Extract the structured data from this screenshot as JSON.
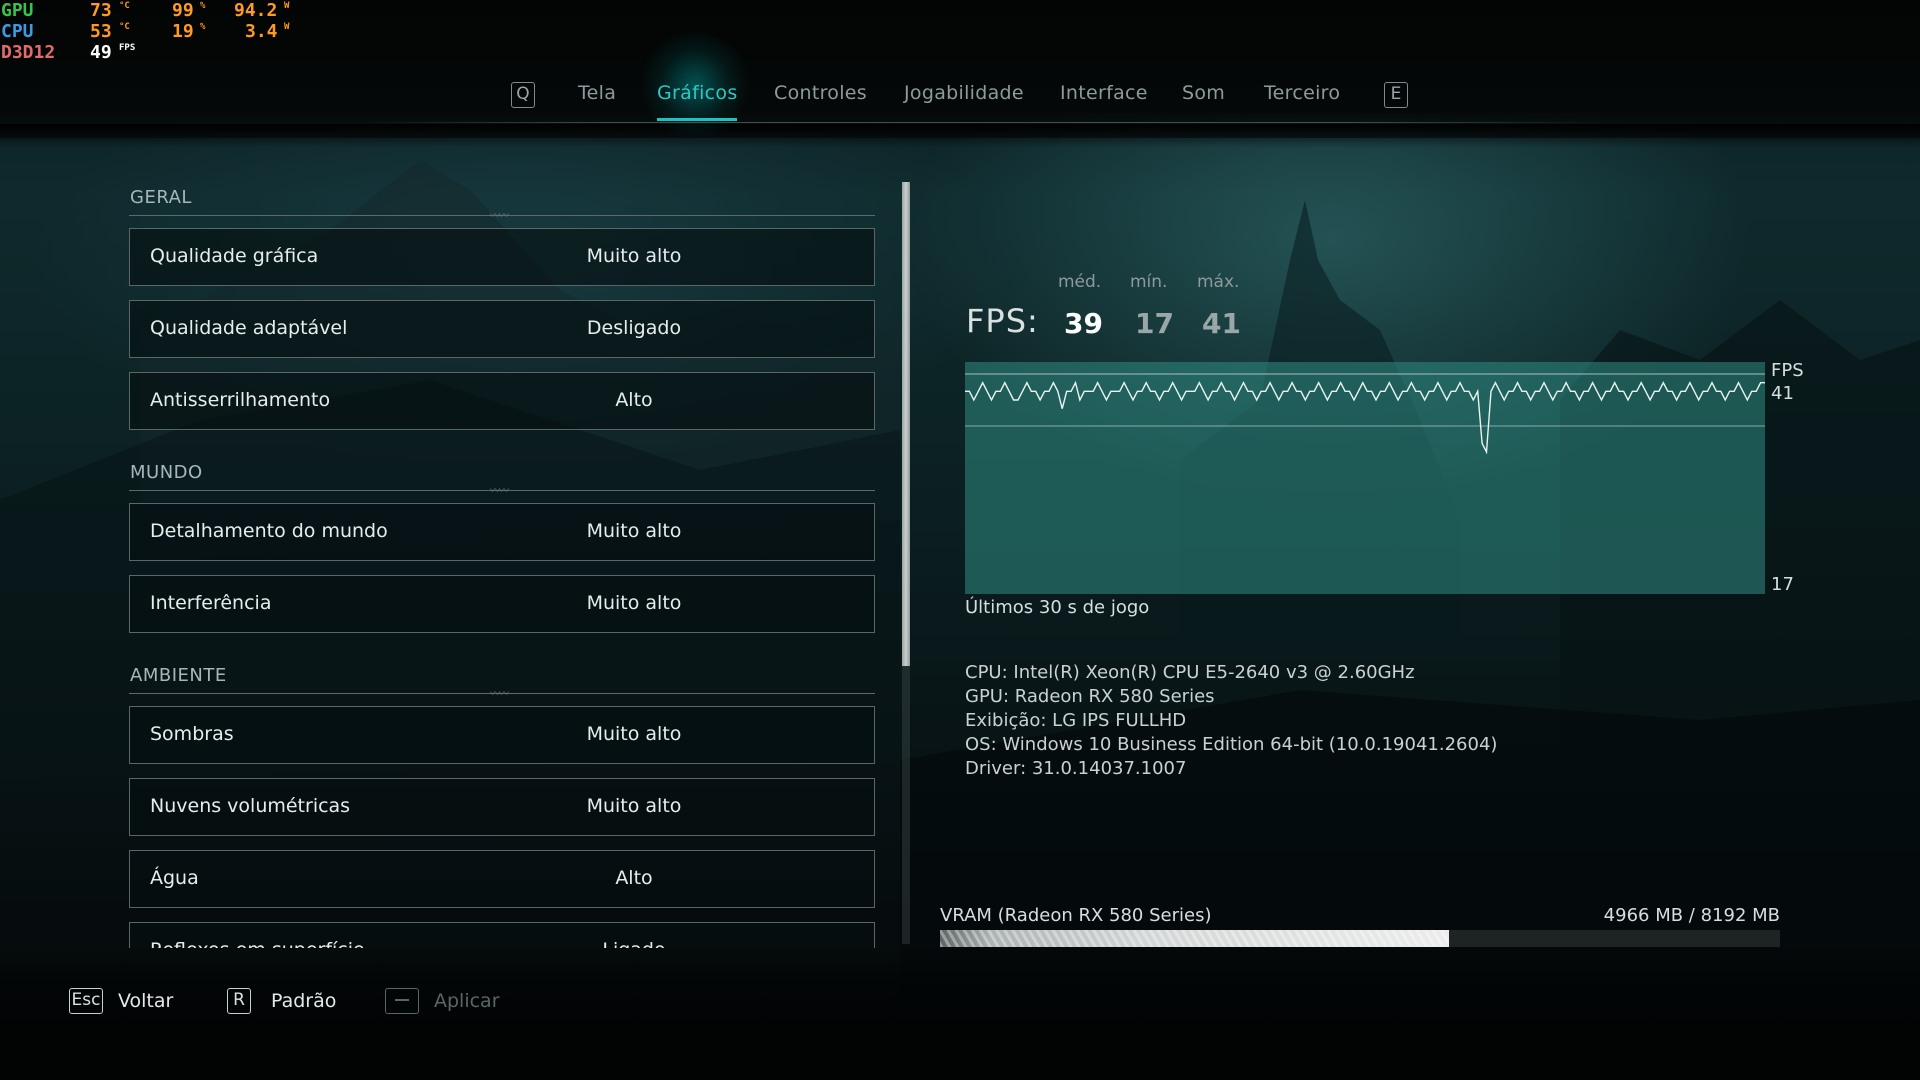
{
  "osd": {
    "rows": [
      {
        "name": "GPU",
        "v1": "73",
        "u1": "°C",
        "v2": "99",
        "u2": "%",
        "v3": "94.2",
        "u3": "W"
      },
      {
        "name": "CPU",
        "v1": "53",
        "u1": "°C",
        "v2": "19",
        "u2": "%",
        "v3": "3.4",
        "u3": "W"
      },
      {
        "name": "D3D12",
        "v1": "49",
        "u1": "FPS"
      }
    ],
    "colors": {
      "gpu": "#38c447",
      "cpu": "#3c9be6",
      "d3d": "#e36b6b",
      "values": "#ff9a24"
    }
  },
  "tabs": {
    "prev_key": "Q",
    "next_key": "E",
    "items": [
      {
        "label": "Tela",
        "active": false
      },
      {
        "label": "Gráficos",
        "active": true
      },
      {
        "label": "Controles",
        "active": false
      },
      {
        "label": "Jogabilidade",
        "active": false
      },
      {
        "label": "Interface",
        "active": false
      },
      {
        "label": "Som",
        "active": false
      },
      {
        "label": "Terceiro",
        "active": false
      }
    ],
    "accent_color": "#29c9c4"
  },
  "sections": [
    {
      "title": "GERAL",
      "settings": [
        {
          "label": "Qualidade gráfica",
          "value": "Muito alto"
        },
        {
          "label": "Qualidade adaptável",
          "value": "Desligado"
        },
        {
          "label": "Antisserrilhamento",
          "value": "Alto"
        }
      ]
    },
    {
      "title": "MUNDO",
      "settings": [
        {
          "label": "Detalhamento do mundo",
          "value": "Muito alto"
        },
        {
          "label": "Interferência",
          "value": "Muito alto"
        }
      ]
    },
    {
      "title": "AMBIENTE",
      "settings": [
        {
          "label": "Sombras",
          "value": "Muito alto"
        },
        {
          "label": "Nuvens volumétricas",
          "value": "Muito alto"
        },
        {
          "label": "Água",
          "value": "Alto"
        },
        {
          "label": "Reflexos em superfície",
          "value": "Ligado"
        }
      ]
    }
  ],
  "fps": {
    "label": "FPS:",
    "avg_label": "méd.",
    "min_label": "mín.",
    "max_label": "máx.",
    "avg": "39",
    "min": "17",
    "max": "41",
    "graph_top_unit": "FPS",
    "graph_top_value": "41",
    "graph_bottom_value": "17",
    "caption": "Últimos 30 s de jogo"
  },
  "chart_data": {
    "type": "line",
    "series": [
      {
        "values": [
          39,
          39,
          38,
          39,
          40,
          39,
          38,
          39,
          39,
          40,
          39,
          38,
          38,
          39,
          40,
          39,
          39,
          38,
          39,
          39,
          40,
          39,
          37,
          39,
          39,
          40,
          38,
          39,
          39,
          39,
          40,
          39,
          38,
          39,
          39,
          39,
          40,
          39,
          38,
          39,
          39,
          40,
          39,
          39,
          38,
          39,
          39,
          40,
          39,
          38,
          39,
          39,
          39,
          40,
          39,
          38,
          39,
          39,
          40,
          39,
          39,
          38,
          39,
          40,
          39,
          39,
          38,
          39,
          39,
          40,
          39,
          38,
          39,
          39,
          40,
          39,
          39,
          38,
          39,
          39,
          40,
          39,
          38,
          39,
          39,
          40,
          39,
          39,
          38,
          39,
          40,
          39,
          39,
          38,
          39,
          39,
          40,
          39,
          38,
          39,
          39,
          40,
          39,
          39,
          38,
          39,
          39,
          40,
          39,
          38,
          39,
          39,
          40,
          39,
          39,
          38,
          39,
          33,
          32,
          39,
          40,
          39,
          38,
          39,
          39,
          40,
          39,
          39,
          38,
          39,
          39,
          40,
          39,
          38,
          39,
          39,
          40,
          39,
          39,
          38,
          39,
          39,
          40,
          39,
          38,
          39,
          39,
          40,
          39,
          39,
          38,
          39,
          39,
          40,
          39,
          38,
          39,
          39,
          40,
          39,
          39,
          38,
          39,
          39,
          40,
          39,
          38,
          39,
          39,
          40,
          39,
          39,
          38,
          39,
          39,
          40,
          39,
          38,
          39,
          39,
          40,
          40
        ]
      }
    ],
    "ylim": [
      17,
      41
    ]
  },
  "sysinfo": {
    "lines": [
      "CPU: Intel(R) Xeon(R) CPU E5-2640 v3 @ 2.60GHz",
      "GPU: Radeon RX 580 Series",
      "Exibição: LG IPS FULLHD",
      "OS: Windows 10 Business Edition 64-bit (10.0.19041.2604)",
      "Driver: 31.0.14037.1007"
    ]
  },
  "vram": {
    "label": "VRAM (Radeon RX 580 Series)",
    "used_mb": 4966,
    "total_mb": 8192,
    "value_text": "4966 MB / 8192 MB"
  },
  "actions": {
    "back_key": "Esc",
    "back_label": "Voltar",
    "default_key": "R",
    "default_label": "Padrão",
    "apply_label": "Aplicar"
  }
}
